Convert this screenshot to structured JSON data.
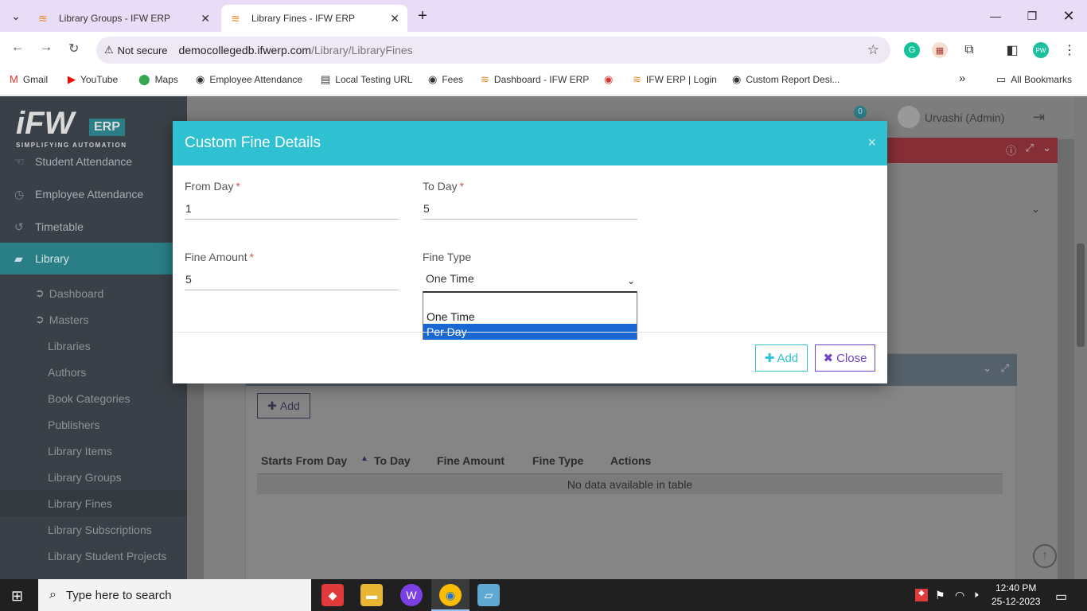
{
  "browser": {
    "tabs": [
      {
        "title": "Library Groups - IFW ERP",
        "active": false
      },
      {
        "title": "Library Fines - IFW ERP",
        "active": true
      }
    ],
    "new_tab": "+",
    "not_secure": "Not secure",
    "url_host": "democollegedb.ifwerp.com",
    "url_path": "/Library/LibraryFines",
    "bookmarks": [
      "Gmail",
      "YouTube",
      "Maps",
      "Employee Attendance",
      "Local Testing URL",
      "Fees",
      "Dashboard - IFW ERP",
      "IFW ERP | Login",
      "Custom Report Desi..."
    ],
    "bookmarks_overflow": "»",
    "all_bookmarks": "All Bookmarks"
  },
  "app": {
    "logo_text": "iFW",
    "logo_badge": "ERP",
    "logo_tagline": "SIMPLIFYING AUTOMATION",
    "notification_count": "0",
    "user_name": "Urvashi (Admin)",
    "sidebar": {
      "items": [
        {
          "label": "Student Attendance"
        },
        {
          "label": "Employee Attendance"
        },
        {
          "label": "Timetable"
        },
        {
          "label": "Library"
        }
      ],
      "library_sub": [
        {
          "label": "Dashboard"
        },
        {
          "label": "Masters"
        }
      ],
      "masters_sub": [
        "Libraries",
        "Authors",
        "Book Categories",
        "Publishers",
        "Library Items",
        "Library Groups",
        "Library Fines",
        "Library Subscriptions",
        "Library Student Projects"
      ]
    },
    "background": {
      "add_button": "Add",
      "table_headers": [
        "Starts From Day",
        "To Day",
        "Fine Amount",
        "Fine Type",
        "Actions"
      ],
      "no_data": "No data available in table"
    }
  },
  "modal": {
    "title": "Custom Fine Details",
    "close": "×",
    "fields": {
      "from_day": {
        "label": "From Day",
        "value": "1",
        "required": "*"
      },
      "to_day": {
        "label": "To Day",
        "value": "5",
        "required": "*"
      },
      "fine_amount": {
        "label": "Fine Amount",
        "value": "5",
        "required": "*"
      },
      "fine_type": {
        "label": "Fine Type",
        "value": "One Time",
        "options": [
          "",
          "One Time",
          "Per Day"
        ],
        "highlighted": "Per Day"
      }
    },
    "buttons": {
      "add": "Add",
      "close": "Close"
    }
  },
  "taskbar": {
    "search_placeholder": "Type here to search",
    "time": "12:40 PM",
    "date": "25-12-2023"
  },
  "colors": {
    "modal_header": "#2fc1d2",
    "sidebar_active": "#2a7f87",
    "option_highlight": "#1967d2",
    "close_button": "#6f42c1"
  }
}
